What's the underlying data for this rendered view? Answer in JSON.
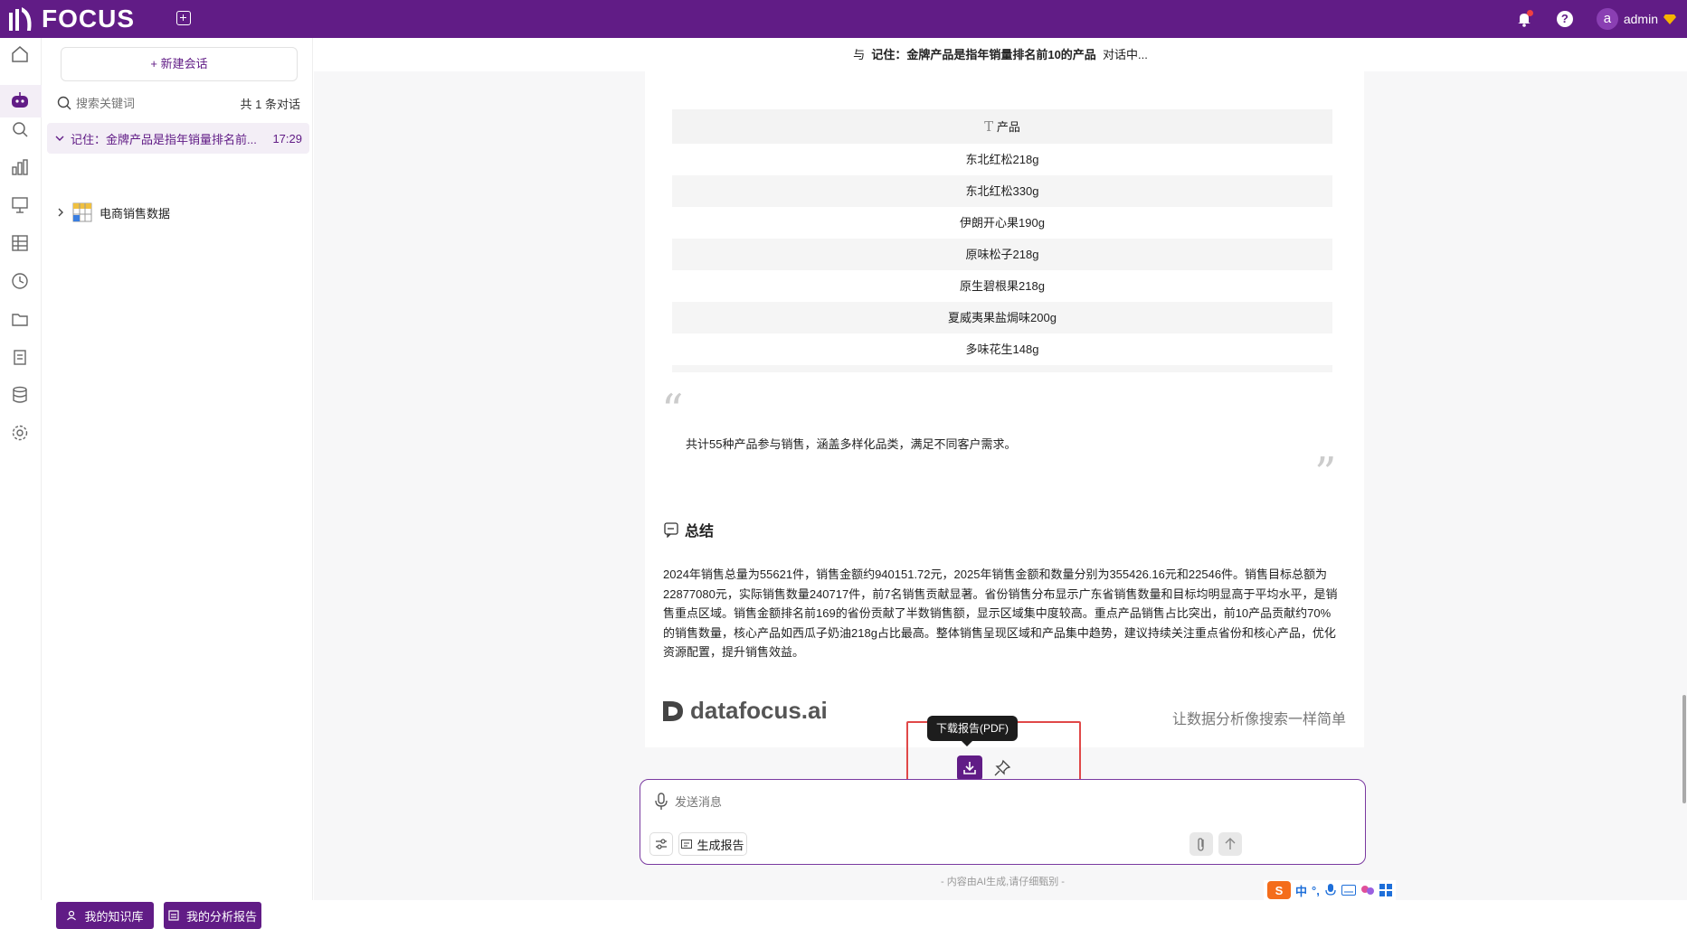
{
  "app": {
    "logo_text": "FOCUS",
    "brand_color": "#611c86"
  },
  "topbar": {
    "user_name": "admin",
    "help_label": "?",
    "avatar_letter": "a"
  },
  "sidebar_rail": {
    "items": [
      "home-icon",
      "robot-icon",
      "search-icon",
      "chart-icon",
      "presentation-icon",
      "table-icon",
      "history-icon",
      "folder-icon",
      "clipboard-icon",
      "database-icon",
      "gear-icon"
    ]
  },
  "panel": {
    "new_chat_label": "+ 新建会话",
    "search_placeholder": "搜索关键词",
    "count_label": "共 1 条对话",
    "conversation": {
      "title": "记住：金牌产品是指年销量排名前...",
      "time": "17:29"
    },
    "tree_item": "电商销售数据",
    "knowledge_button": "我的知识库",
    "reports_button": "我的分析报告"
  },
  "main": {
    "header_prefix": "与",
    "header_title": "记住：金牌产品是指年销量排名前10的产品",
    "header_suffix": "对话中...",
    "table": {
      "header_icon": "text-type-icon",
      "header": "产品",
      "rows": [
        "东北红松218g",
        "东北红松330g",
        "伊朗开心果190g",
        "原味松子218g",
        "原生碧根果218g",
        "夏威夷果盐焗味200g",
        "多味花生148g"
      ]
    },
    "quote": "共计55种产品参与销售，涵盖多样化品类，满足不同客户需求。",
    "summary_title": "总结",
    "summary_body": "2024年销售总量为55621件，销售金额约940151.72元，2025年销售金额和数量分别为355426.16元和22546件。销售目标总额为22877080元，实际销售数量240717件，前7名销售贡献显著。省份销售分布显示广东省销售数量和目标均明显高于平均水平，是销售重点区域。销售金额排名前169的省份贡献了半数销售额，显示区域集中度较高。重点产品销售占比突出，前10产品贡献约70%的销售数量，核心产品如西瓜子奶油218g占比最高。整体销售呈现区域和产品集中趋势，建议持续关注重点省份和核心产品，优化资源配置，提升销售效益。",
    "brand_text": "datafocus.ai",
    "slogan": "让数据分析像搜索一样简单",
    "tooltip": "下载报告(PDF)"
  },
  "composer": {
    "placeholder": "发送消息",
    "report_button": "生成报告",
    "disclaimer": "- 内容由AI生成,请仔细甄别 -"
  },
  "ime": {
    "mode": "中",
    "punct": "°,"
  }
}
